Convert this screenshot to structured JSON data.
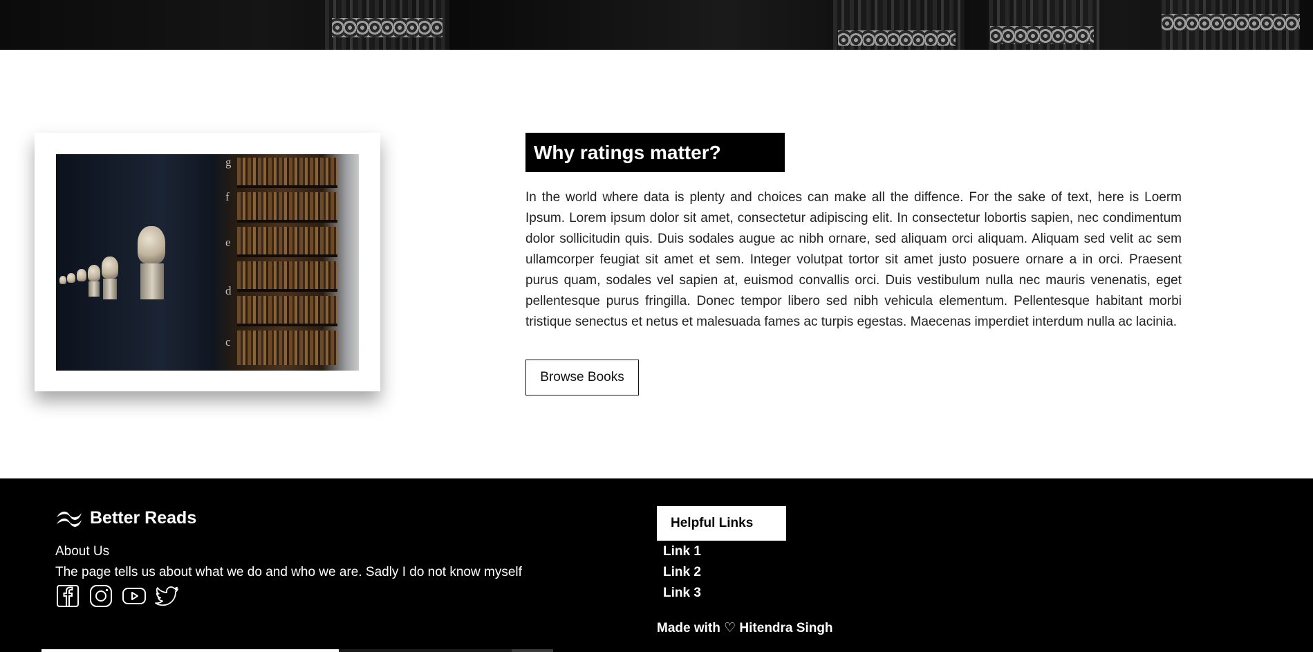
{
  "section": {
    "heading": "Why ratings matter?",
    "body": "In the world where data is plenty and choices can make all the diffence. For the sake of text, here is Loerm Ipsum. Lorem ipsum dolor sit amet, consectetur adipiscing elit. In consectetur lobortis sapien, nec condimentum dolor sollicitudin quis. Duis sodales augue ac nibh ornare, sed aliquam orci aliquam. Aliquam sed velit ac sem ullamcorper feugiat sit amet et sem. Integer volutpat tortor sit amet justo posuere ornare a in orci. Praesent purus quam, sodales vel sapien at, euismod convallis orci. Duis vestibulum nulla nec mauris venenatis, eget pellentesque purus fringilla. Donec tempor libero sed nibh vehicula elementum. Pellentesque habitant morbi tristique senectus et netus et malesuada fames ac turpis egestas. Maecenas imperdiet interdum nulla ac lacinia.",
    "button_label": "Browse Books",
    "image_icon": "library-photo"
  },
  "footer": {
    "brand_name": "Better Reads",
    "brand_icon": "wave-logo-icon",
    "about_title": "About Us",
    "about_text": "The page tells us about what we do and who we are. Sadly I do not know myself",
    "socials": [
      "facebook-icon",
      "instagram-icon",
      "youtube-icon",
      "twitter-icon"
    ],
    "links_heading": "Helpful Links",
    "links": [
      "Link 1",
      "Link 2",
      "Link 3"
    ],
    "made_with": "Made with ♡ Hitendra Singh"
  },
  "colors": {
    "background": "#ffffff",
    "footer": "#000000",
    "accent": "#000000"
  }
}
